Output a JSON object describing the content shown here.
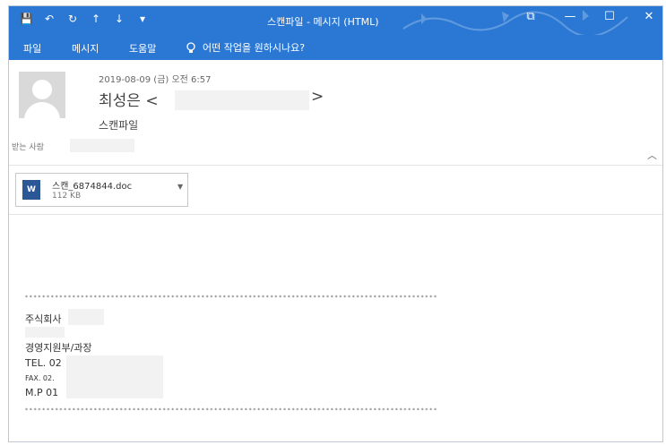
{
  "window": {
    "title": "스캔파일 - 메시지 (HTML)",
    "qat": [
      "💾",
      "↶",
      "↻",
      "↑",
      "↓",
      "▾"
    ],
    "controls": [
      "⧉",
      "—",
      "☐",
      "✕"
    ]
  },
  "ribbon": {
    "tabs": [
      "파일",
      "메시지",
      "도움말"
    ],
    "tell_icon": "lightbulb-icon",
    "tell_me": "어떤 작업을 원하시나요?"
  },
  "message": {
    "date": "2019-08-09 (금) 오전 6:57",
    "sender_name": "최성은",
    "sender_open": "<",
    "sender_close": ">",
    "subject": "스캔파일",
    "to_label": "받는 사람"
  },
  "attachment": {
    "name": "스캔_6874844.doc",
    "size": "112 KB",
    "icon": "W"
  },
  "signature": {
    "stars": "************************************************************************************************",
    "company": "주식회사",
    "dept": "경영지원부/과장",
    "tel": "TEL. 02",
    "fax": "FAX. 02.",
    "mp": "M.P 01"
  },
  "colors": {
    "accent": "#2b78d4"
  }
}
